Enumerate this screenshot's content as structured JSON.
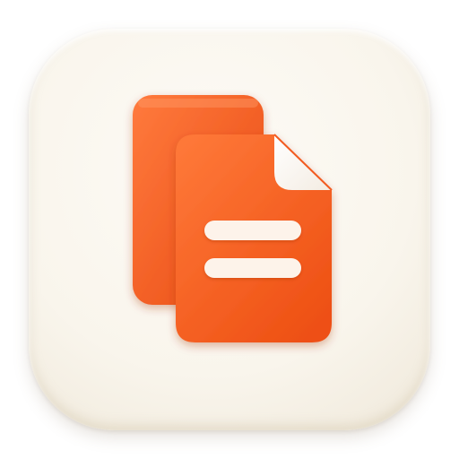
{
  "icon": {
    "name": "copy-documents",
    "background_color": "#f9f5ec",
    "accent_color": "#f25a1f",
    "line_color": "#fdf3ea"
  }
}
